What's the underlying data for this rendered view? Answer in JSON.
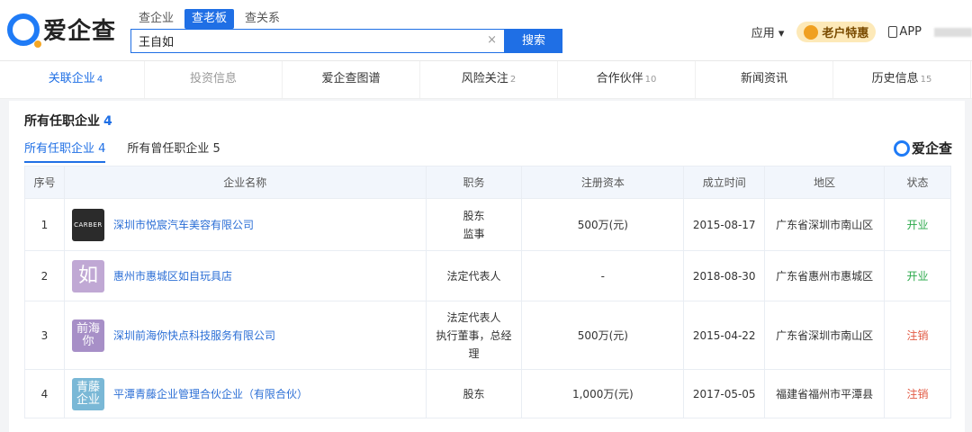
{
  "header": {
    "logo_text": "爱企查",
    "search_tabs": [
      "查企业",
      "查老板",
      "查关系"
    ],
    "search_value": "王自如",
    "clear_icon": "×",
    "search_button": "搜索",
    "nav_apps": "应用 ▾",
    "promo": "老户特惠",
    "nav_app": "APP"
  },
  "tabs": [
    {
      "label": "关联企业",
      "count": "4"
    },
    {
      "label": "投资信息",
      "count": ""
    },
    {
      "label": "爱企查图谱",
      "count": ""
    },
    {
      "label": "风险关注",
      "count": "2"
    },
    {
      "label": "合作伙伴",
      "count": "10"
    },
    {
      "label": "新闻资讯",
      "count": ""
    },
    {
      "label": "历史信息",
      "count": "15"
    }
  ],
  "section": {
    "title": "所有任职企业",
    "count": "4",
    "subtabs": [
      {
        "label": "所有任职企业 4"
      },
      {
        "label": "所有曾任职企业 5"
      }
    ],
    "watermark": "爱企查"
  },
  "table": {
    "headers": [
      "序号",
      "企业名称",
      "职务",
      "注册资本",
      "成立时间",
      "地区",
      "状态"
    ],
    "rows": [
      {
        "idx": "1",
        "badge": "CARBER",
        "badge_color": "#2b2b2b",
        "name": "深圳市悦宸汽车美容有限公司",
        "role_lines": [
          "股东",
          "监事"
        ],
        "capital": "500万(元)",
        "date": "2015-08-17",
        "region": "广东省深圳市南山区",
        "status": "开业",
        "status_type": "open"
      },
      {
        "idx": "2",
        "badge": "如",
        "badge_color": "#c0a8d4",
        "name": "惠州市惠城区如自玩具店",
        "role_lines": [
          "法定代表人"
        ],
        "capital": "-",
        "date": "2018-08-30",
        "region": "广东省惠州市惠城区",
        "status": "开业",
        "status_type": "open"
      },
      {
        "idx": "3",
        "badge": "前海你",
        "badge_color": "#a78fc7",
        "name": "深圳前海你快点科技服务有限公司",
        "role_lines": [
          "法定代表人",
          "执行董事，总经",
          "理"
        ],
        "capital": "500万(元)",
        "date": "2015-04-22",
        "region": "广东省深圳市南山区",
        "status": "注销",
        "status_type": "closed"
      },
      {
        "idx": "4",
        "badge": "青藤企业",
        "badge_color": "#7ab8d6",
        "name": "平潭青藤企业管理合伙企业（有限合伙）",
        "role_lines": [
          "股东"
        ],
        "capital": "1,000万(元)",
        "date": "2017-05-05",
        "region": "福建省福州市平潭县",
        "status": "注销",
        "status_type": "closed"
      }
    ]
  }
}
